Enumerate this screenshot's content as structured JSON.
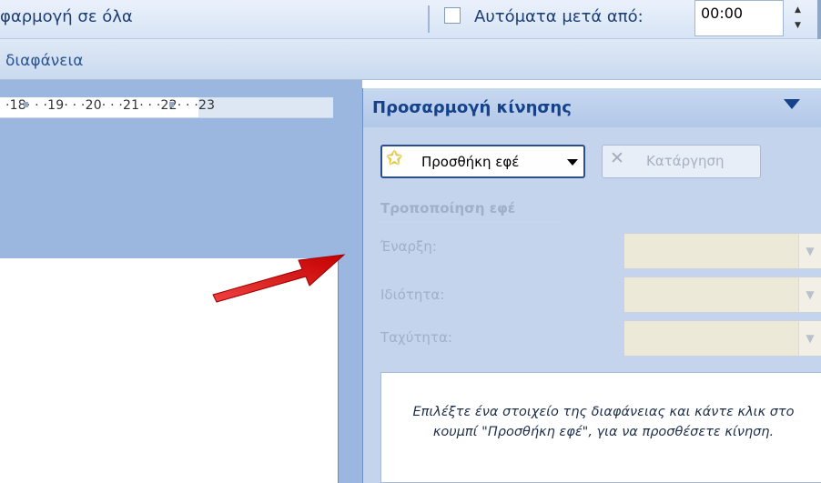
{
  "ribbon": {
    "apply_all": "φαρμογή σε όλα",
    "auto_after_label": "Αυτόματα μετά από:",
    "auto_after_value": "00:00"
  },
  "slide_tab": "διαφάνεια",
  "ruler": "·18· · ·19· · ·20· · ·21· · ·22· · ·23",
  "task_pane": {
    "title": "Προσαρμογή κίνησης",
    "add_effect": "Προσθήκη εφέ",
    "remove": "Κατάργηση",
    "modify_title": "Τροποποίηση εφέ",
    "start_label": "Έναρξη:",
    "property_label": "Ιδιότητα:",
    "speed_label": "Ταχύτητα:",
    "hint": "Επιλέξτε ένα στοιχείο της διαφάνειας και κάντε κλικ στο κουμπί \"Προσθήκη εφέ\", για να προσθέσετε κίνηση."
  },
  "colors": {
    "pane_title": "#15428b",
    "arrow": "#e01b1b",
    "disabled_text": "#9fb0c8"
  }
}
